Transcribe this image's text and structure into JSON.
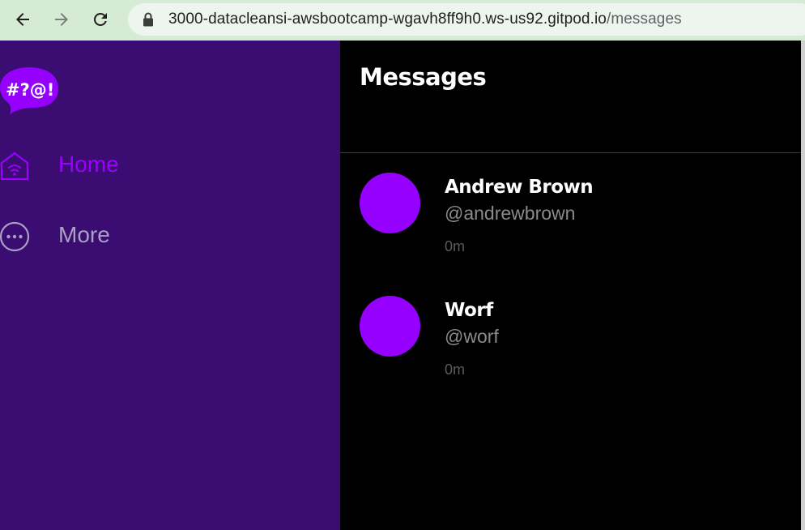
{
  "browser": {
    "url_host": "3000-datacleansi-awsbootcamp-wgavh8ff9h0.ws-us92.gitpod.io",
    "url_path": "/messages",
    "icons": {
      "back": "arrow-left-icon",
      "forward": "arrow-right-icon",
      "reload": "reload-icon",
      "lock": "lock-icon"
    }
  },
  "sidebar": {
    "logo_text": "#?@!",
    "items": [
      {
        "label": "Home",
        "icon": "home-icon",
        "active": true,
        "color": "#9b00ff"
      },
      {
        "label": "More",
        "icon": "more-icon",
        "active": false,
        "color": "#a8a0c4"
      }
    ],
    "background": "#3b0c72"
  },
  "main": {
    "title": "Messages",
    "conversations": [
      {
        "display_name": "Andrew Brown",
        "handle": "@andrewbrown",
        "time": "0m",
        "avatar_color": "#9500ff"
      },
      {
        "display_name": "Worf",
        "handle": "@worf",
        "time": "0m",
        "avatar_color": "#9500ff"
      }
    ]
  }
}
